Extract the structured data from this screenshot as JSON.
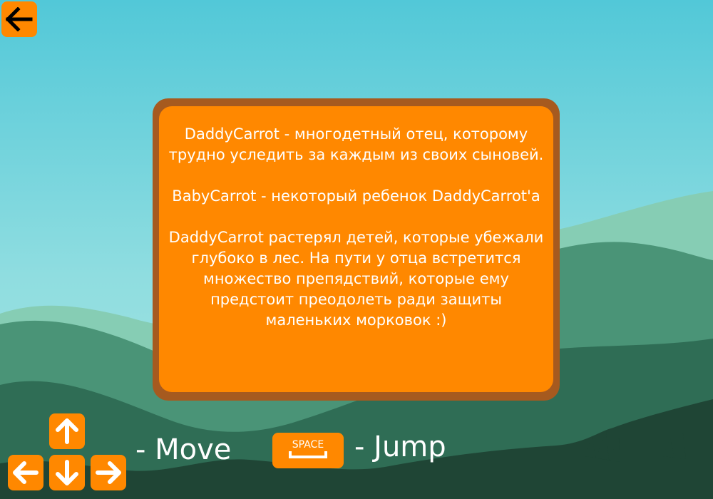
{
  "colors": {
    "accent": "#ff8800",
    "panel_border": "#a65a1f",
    "text": "#ffffff"
  },
  "toolbar": {
    "back_icon": "arrow-left-icon"
  },
  "story": {
    "paragraph1": "DaddyCarrot - многодетный отец, которому трудно уследить за каждым из своих сыновей.",
    "paragraph2": "BabyCarrot - некоторый ребенок DaddyCarrot'а",
    "paragraph3": "DaddyCarrot растерял детей, которые убежали глубоко в лес. На пути у отца встретится множество препядствий, которые ему предстоит преодолеть ради защиты маленьких морковок :)"
  },
  "controls": {
    "move_icons": [
      "arrow-up-icon",
      "arrow-left-icon",
      "arrow-down-icon",
      "arrow-right-icon"
    ],
    "move_label": "- Move",
    "space_key_label": "SPACE",
    "jump_label": "- Jump"
  }
}
